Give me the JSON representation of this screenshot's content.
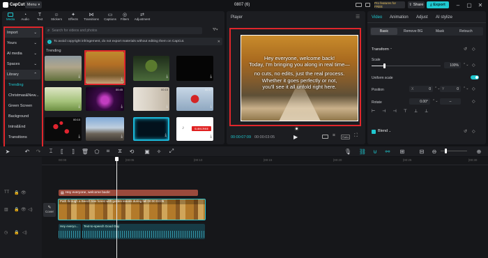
{
  "titlebar": {
    "app_name": "CapCut",
    "menu_label": "Menu",
    "project_title": "0807 (6)",
    "pro_label": "Pro features for FREE",
    "share_label": "Share",
    "export_label": "Export"
  },
  "toolbar": {
    "items": [
      "Media",
      "Audio",
      "Text",
      "Stickers",
      "Effects",
      "Transitions",
      "Captions",
      "Filters",
      "Adjustment"
    ]
  },
  "sidebar": {
    "items": [
      "Import",
      "Yours",
      "AI media",
      "Spaces",
      "Library",
      "Trending",
      "Christmas&New...",
      "Green Screen",
      "Background",
      "Intro&End",
      "Transitions"
    ]
  },
  "media": {
    "search_placeholder": "Search for videos and photos",
    "notice": "To avoid copyright infringement, do not export materials without editing them on CapCut.",
    "section_title": "Trending",
    "durations": [
      "00:45",
      "00:15",
      "00:17",
      "00:10"
    ],
    "subscribe_label": "SUBSCRIBE"
  },
  "player": {
    "title": "Player",
    "caption_lines": [
      "Hey everyone, welcome back!",
      "Today, I'm bringing you along in real time—",
      "no cuts, no edits, just the real process.",
      "Whether it goes perfectly or not,",
      "you'll see it all unfold right here."
    ],
    "current_time": "00:00:07:09",
    "total_time": "00:00:03:05",
    "ratio_label": "Ratio"
  },
  "inspector": {
    "tabs": [
      "Video",
      "Animation",
      "Adjust",
      "AI stylize"
    ],
    "subtabs": [
      "Basic",
      "Remove BG",
      "Mask",
      "Retouch"
    ],
    "transform_label": "Transform",
    "scale_label": "Scale",
    "scale_value": "100%",
    "uniform_scale_label": "Uniform scale",
    "position_label": "Position",
    "pos_x_label": "X",
    "pos_x_value": "0",
    "pos_y_label": "Y",
    "pos_y_value": "0",
    "rotate_label": "Rotate",
    "rotate_value": "0.00°",
    "rotate_dash": "–",
    "blend_label": "Blend",
    "scale_fraction": 0.18
  },
  "timeline": {
    "ruler_ticks": [
      "00:00",
      "|00:05",
      "|00:10",
      "|00:15",
      "|00:20",
      "|00:25",
      "|00:30"
    ],
    "text_clip": "Hey everyone, welcome back!",
    "video_clip": "Path through a Beech tree forest with golden leaves during fall  00:00:03:05",
    "cover_label": "Cover",
    "audio_clip_a": "Hey everyo...",
    "audio_clip_b": "Text-to-speech  Good Guy"
  },
  "colors": {
    "accent": "#1fc8d0",
    "highlight": "#e0262b",
    "text_clip": "#9b4a3c",
    "video_border": "#2ec9d4",
    "audio_clip": "#173b45"
  }
}
